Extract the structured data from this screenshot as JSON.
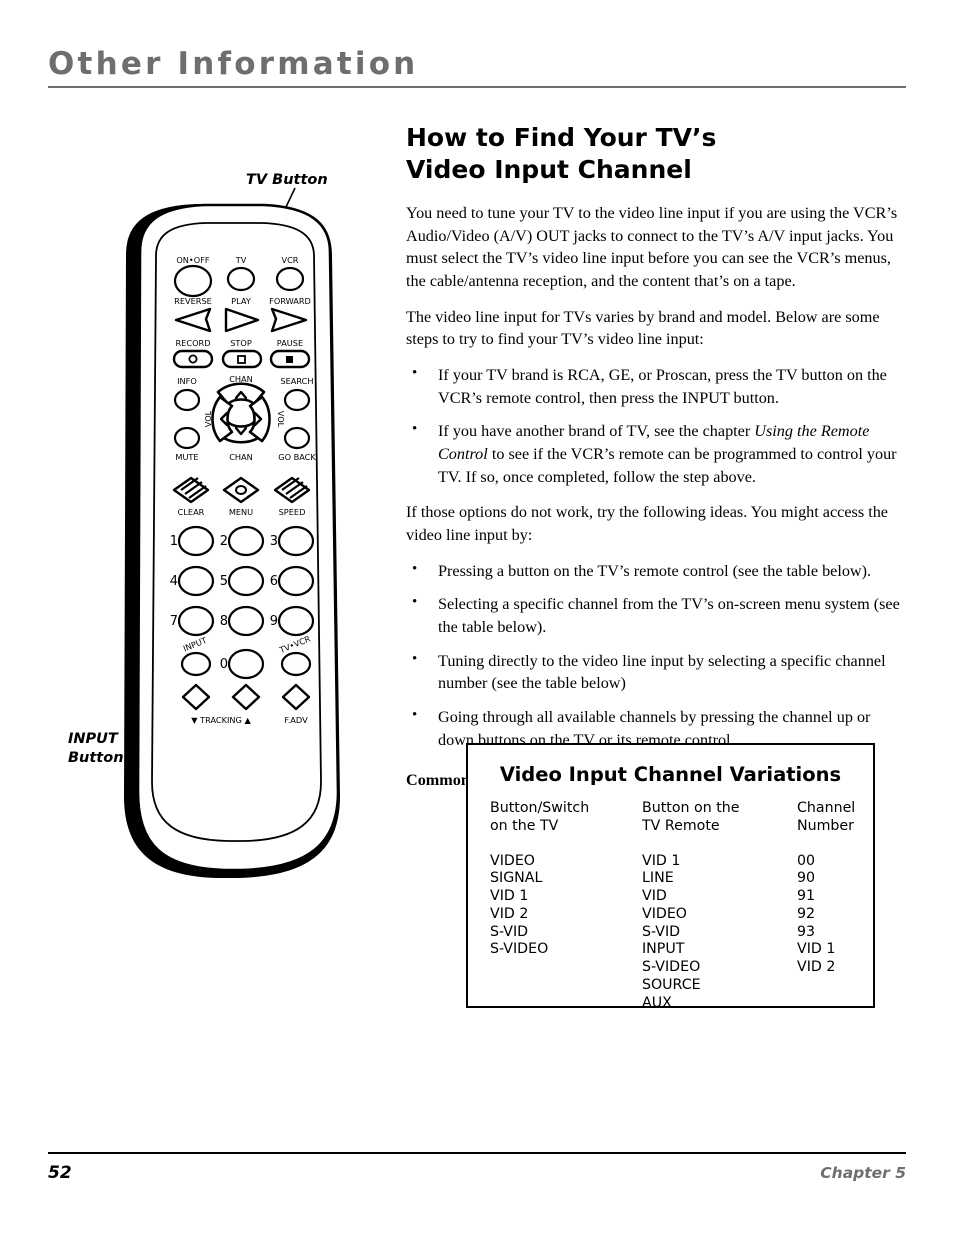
{
  "page_header": {
    "title": "Other Information"
  },
  "main": {
    "title_line1": "How to Find Your TV’s",
    "title_line2": "Video Input Channel",
    "paragraph1": "You need to tune your TV to the video line input if you are using the VCR’s Audio/Video (A/V) OUT jacks to connect to the TV’s A/V input jacks. You must select the TV’s video line input before you can see the VCR’s menus, the cable/antenna reception, and the content that’s on a tape.",
    "paragraph2": "The video line input for TVs varies by brand and model. Below are some steps to try to find your TV’s video line input:",
    "bullet1": "If your TV brand is RCA, GE, or Proscan, press the TV button on the VCR’s remote control, then press the INPUT button.",
    "bullet2_part1": "If you have another brand of TV, see the chapter ",
    "bullet2_italic": "Using the Remote Control",
    "bullet2_part2": " to see if the VCR’s remote can be programmed to control your TV. If so, once completed, follow the step above.",
    "paragraph3": "If those options do not work, try the following ideas. You might access the video line input by:",
    "bullet3": "Pressing a button on the TV’s remote control (see the table below).",
    "bullet4": "Selecting a specific channel from the TV’s on-screen menu system (see the table below).",
    "bullet5": "Tuning directly to the video line input by selecting a specific channel number (see the table below)",
    "bullet6": "Going through all available channels by pressing the channel up or down buttons on the TV or its remote control.",
    "scenarios_heading": "Common Video Line Input scenarios:",
    "bullet_glyph": "•"
  },
  "table": {
    "title": "Video Input Channel Variations",
    "headers": [
      {
        "line1": "Button/Switch",
        "line2": "on the TV"
      },
      {
        "line1": "Button on the",
        "line2": "TV Remote"
      },
      {
        "line1": "Channel",
        "line2": "Number"
      }
    ],
    "rows": [
      {
        "tv": "VIDEO",
        "remote": "VID 1",
        "channel": "00"
      },
      {
        "tv": "SIGNAL",
        "remote": "LINE",
        "channel": "90"
      },
      {
        "tv": "VID 1",
        "remote": "VID",
        "channel": "91"
      },
      {
        "tv": "VID 2",
        "remote": "VIDEO",
        "channel": "92"
      },
      {
        "tv": "S-VID",
        "remote": "S-VID",
        "channel": "93"
      },
      {
        "tv": "S-VIDEO",
        "remote": "INPUT",
        "channel": "VID 1"
      },
      {
        "tv": "",
        "remote": "S-VIDEO",
        "channel": "VID 2"
      },
      {
        "tv": "",
        "remote": "SOURCE",
        "channel": ""
      },
      {
        "tv": "",
        "remote": "AUX",
        "channel": ""
      }
    ]
  },
  "illustration": {
    "callout_tv": "TV Button",
    "callout_input_line1": "INPUT",
    "callout_input_line2": "Button",
    "remote_buttons": {
      "on_off": "ON•OFF",
      "tv": "TV",
      "vcr": "VCR",
      "reverse": "REVERSE",
      "play": "PLAY",
      "forward": "FORWARD",
      "record": "RECORD",
      "stop": "STOP",
      "pause": "PAUSE",
      "info": "INFO",
      "chan_up": "CHAN",
      "search": "SEARCH",
      "vol_left": "VOL",
      "vol_right": "VOL",
      "mute": "MUTE",
      "chan_down": "CHAN",
      "go_back": "GO BACK",
      "clear": "CLEAR",
      "menu": "MENU",
      "speed": "SPEED",
      "num1": "1",
      "num2": "2",
      "num3": "3",
      "num4": "4",
      "num5": "5",
      "num6": "6",
      "num7": "7",
      "num8": "8",
      "num9": "9",
      "num0": "0",
      "input": "INPUT",
      "tv_vcr": "TV•VCR",
      "tracking": "▼ TRACKING ▲",
      "f_adv": "F.ADV"
    }
  },
  "footer": {
    "page_number": "52",
    "chapter": "Chapter 5"
  },
  "colors": {
    "header_gray": "#6e6e6e",
    "text_black": "#000000",
    "page_bg": "#ffffff"
  }
}
